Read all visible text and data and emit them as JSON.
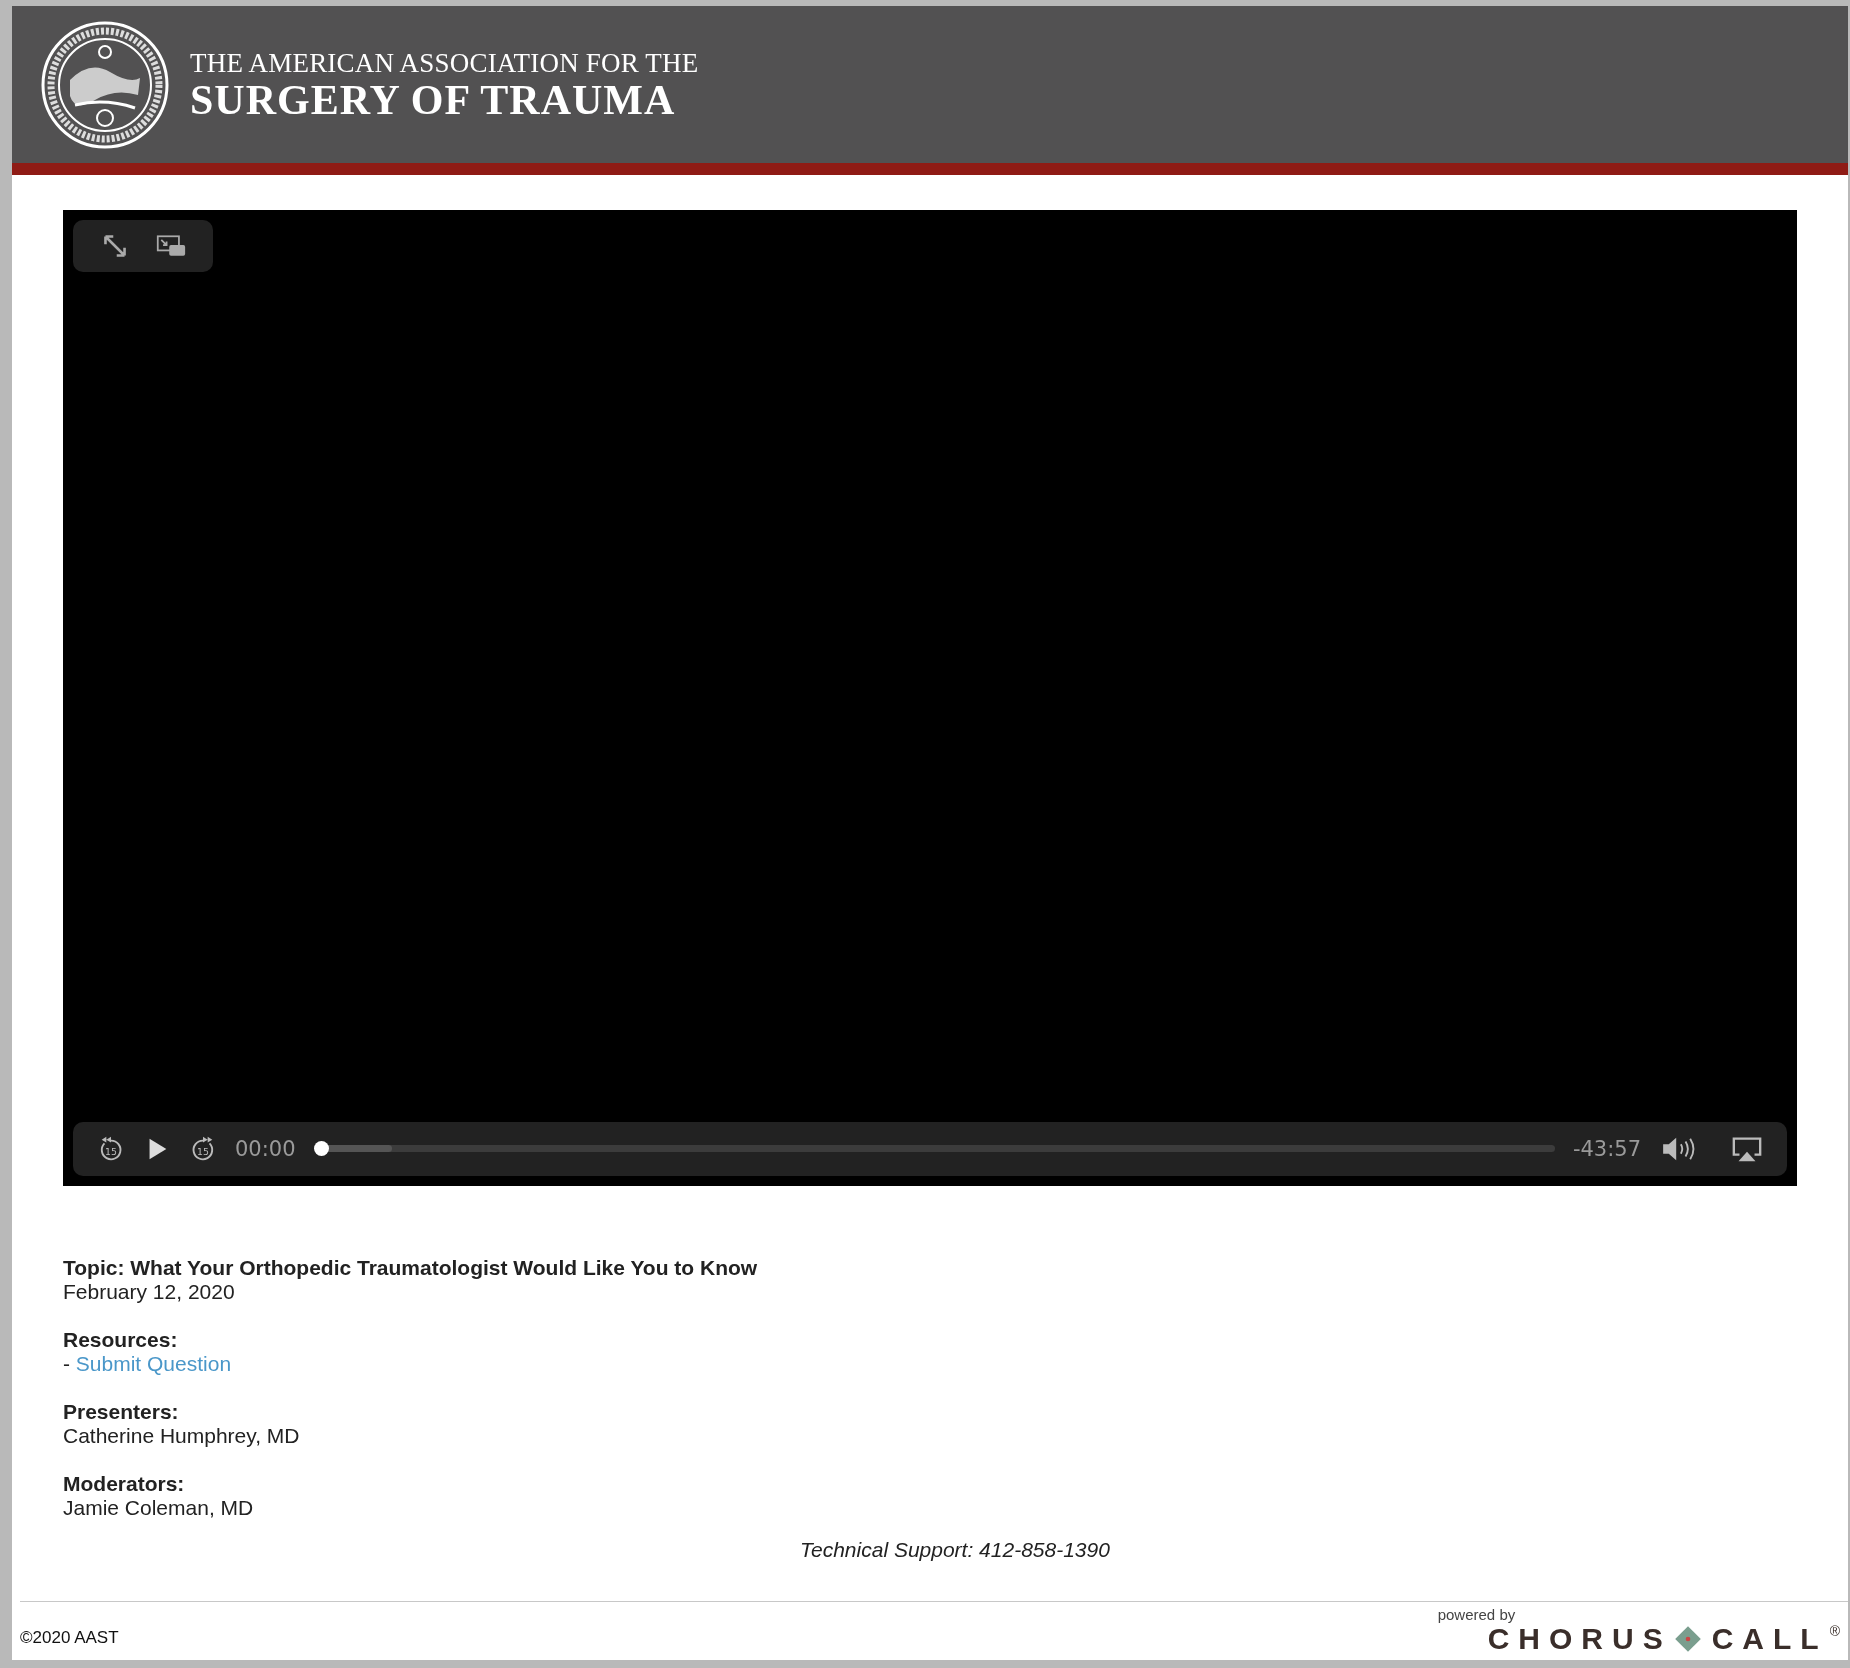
{
  "header": {
    "title_line_1": "THE AMERICAN ASSOCIATION FOR THE",
    "title_line_2": "SURGERY OF TRAUMA"
  },
  "video": {
    "skip_back": "15",
    "skip_forward": "15",
    "current_time": "00:00",
    "remaining_time": "-43:57",
    "level": 0,
    "playing": false
  },
  "details": {
    "topic": "Topic: What Your Orthopedic Traumatologist Would Like You to Know",
    "date": "February 12, 2020",
    "sections": [
      {
        "heading": "Resources:",
        "kind": "links",
        "items": [
          {
            "prefix": "- ",
            "text": "Submit Question"
          }
        ]
      },
      {
        "heading": "Presenters:",
        "kind": "names",
        "items": [
          {
            "text": "Catherine Humphrey, MD"
          }
        ]
      },
      {
        "heading": "Moderators:",
        "kind": "names",
        "items": [
          {
            "text": "Jamie Coleman, MD"
          }
        ]
      }
    ]
  },
  "support": "Technical Support: 412-858-1390",
  "footer": {
    "copyright": "©2020 AAST",
    "powered_by": "powered by",
    "brand_left": "CHORUS",
    "brand_right": "CALL",
    "brand_mark": "®"
  }
}
